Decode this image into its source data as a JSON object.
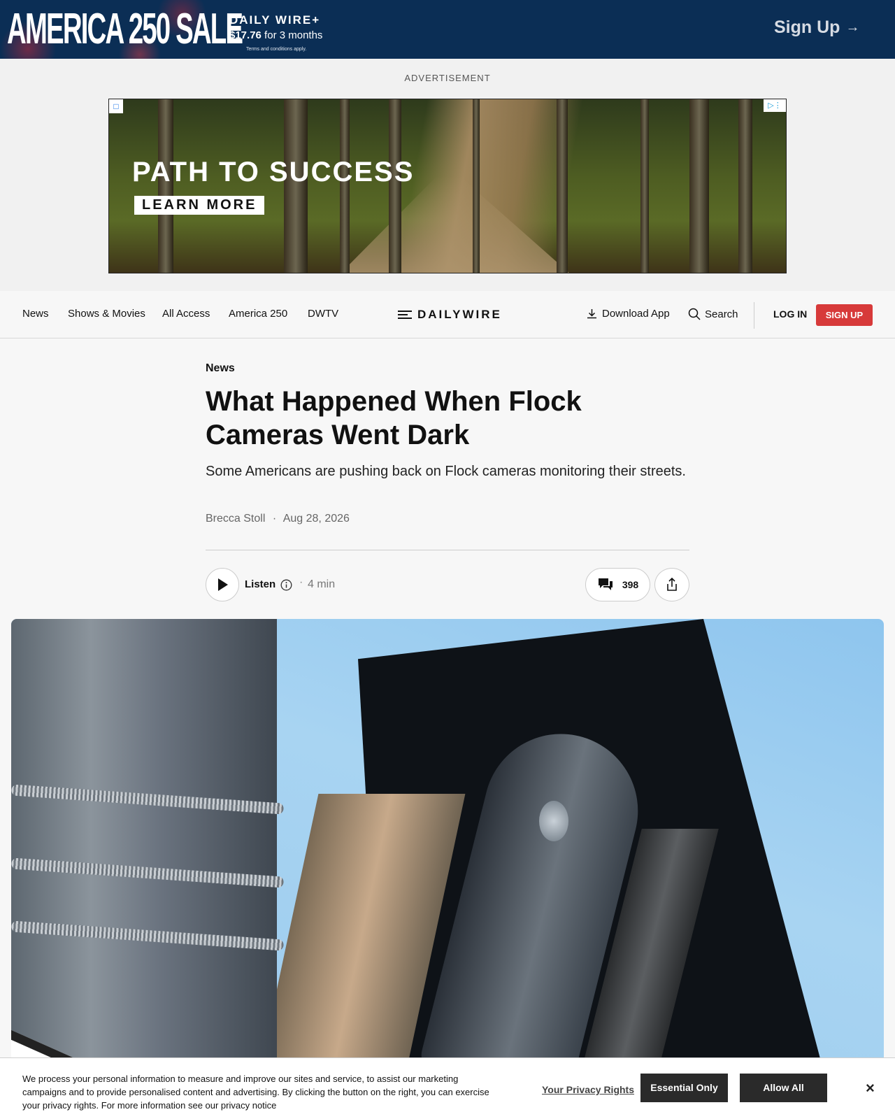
{
  "promo": {
    "title": "AMERICA 250 SALE",
    "brand": "DAILY WIRE+",
    "price": "$17.76",
    "price_suffix": " for 3 months",
    "terms": "Terms and conditions apply.",
    "signup_label": "Sign Up"
  },
  "ad": {
    "label": "ADVERTISEMENT",
    "headline": "PATH TO SUCCESS",
    "cta": "LEARN MORE"
  },
  "nav": {
    "items": [
      "News",
      "Shows & Movies",
      "All Access",
      "America 250",
      "DWTV"
    ],
    "logo": "DAILYWIRE",
    "download": "Download App",
    "search": "Search",
    "login": "LOG IN",
    "signup": "SIGN UP"
  },
  "article": {
    "category": "News",
    "headline": "What Happened When Flock Cameras Went Dark",
    "dek": "Some Americans are pushing back on Flock cameras monitoring their streets.",
    "author": "Brecca Stoll",
    "separator": "·",
    "date": "Aug 28, 2026",
    "listen_label": "Listen",
    "duration": "4 min",
    "comment_count": "398"
  },
  "cookie": {
    "text": "We process your personal information to measure and improve our sites and service, to assist our marketing campaigns and to provide personalised content and advertising. By clicking the button on the right, you can exercise your privacy rights. For more information see our privacy notice",
    "privacy_link": "Your Privacy Rights",
    "essential": "Essential Only",
    "allow": "Allow All",
    "close": "×"
  },
  "colors": {
    "promo_bg": "#0b2e55",
    "signup_red": "#d73a3a",
    "cookie_button": "#2a2a2a"
  }
}
